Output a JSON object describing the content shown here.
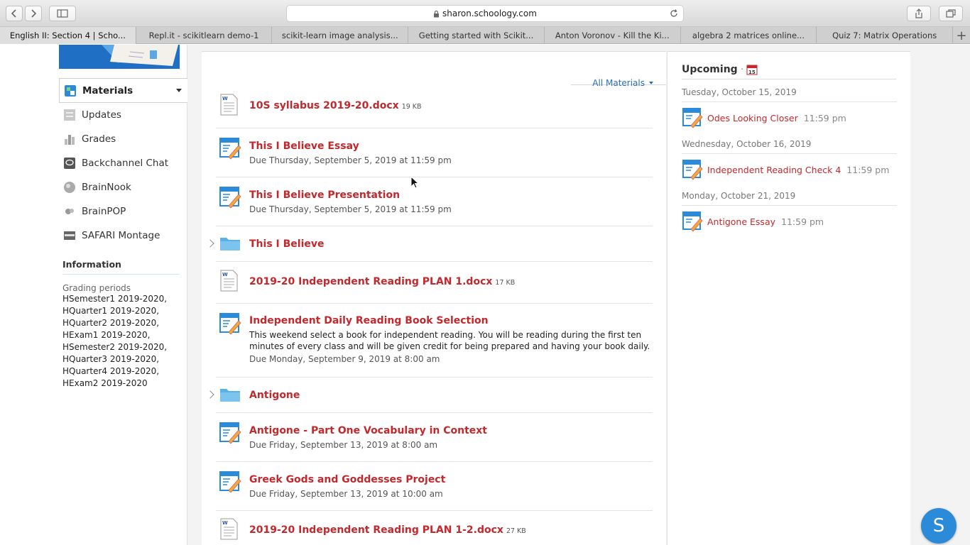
{
  "browser": {
    "url": "sharon.schoology.com",
    "tabs": [
      {
        "label": "English II: Section 4 | Scho..."
      },
      {
        "label": "Repl.it - scikitlearn demo-1"
      },
      {
        "label": "scikit-learn image analysis..."
      },
      {
        "label": "Getting started with Scikit..."
      },
      {
        "label": "Anton Voronov - Kill the Ki..."
      },
      {
        "label": "algebra 2 matrices online..."
      },
      {
        "label": "Quiz 7: Matrix Operations"
      }
    ],
    "new_tab": "+"
  },
  "sidebar": {
    "items": [
      {
        "label": "Materials"
      },
      {
        "label": "Updates"
      },
      {
        "label": "Grades"
      },
      {
        "label": "Backchannel Chat"
      },
      {
        "label": "BrainNook"
      },
      {
        "label": "BrainPOP"
      },
      {
        "label": "SAFARI Montage"
      }
    ],
    "info_title": "Information",
    "grading_label": "Grading periods",
    "grading_periods": [
      "HSemester1 2019-2020,",
      "HQuarter1 2019-2020,",
      "HQuarter2 2019-2020,",
      "HExam1 2019-2020,",
      "HSemester2 2019-2020,",
      "HQuarter3 2019-2020,",
      "HQuarter4 2019-2020,",
      "HExam2 2019-2020"
    ]
  },
  "materials": {
    "filter_label": "All Materials",
    "items": [
      {
        "type": "doc",
        "title": "10S syllabus 2019-20.docx",
        "size": "19 KB"
      },
      {
        "type": "assignment",
        "title": "This I Believe Essay",
        "due": "Due Thursday, September 5, 2019 at 11:59 pm"
      },
      {
        "type": "assignment",
        "title": "This I Believe Presentation",
        "due": "Due Thursday, September 5, 2019 at 11:59 pm"
      },
      {
        "type": "folder",
        "title": "This I Believe"
      },
      {
        "type": "doc",
        "title": "2019-20 Independent Reading PLAN 1.docx",
        "size": "17 KB"
      },
      {
        "type": "assignment",
        "title": "Independent Daily Reading Book Selection",
        "desc": "This weekend select a book for independent reading. You will be reading during the first ten minutes of every class and will be given credit for being prepared and having your book daily.",
        "due": "Due Monday, September 9, 2019 at 8:00 am"
      },
      {
        "type": "folder",
        "title": "Antigone"
      },
      {
        "type": "assignment",
        "title": "Antigone - Part One Vocabulary in Context",
        "due": "Due Friday, September 13, 2019 at 8:00 am"
      },
      {
        "type": "assignment",
        "title": "Greek Gods and Goddesses Project",
        "due": "Due Friday, September 13, 2019 at 10:00 am"
      },
      {
        "type": "doc",
        "title": "2019-20 Independent Reading PLAN 1-2.docx",
        "size": "27 KB"
      }
    ]
  },
  "upcoming": {
    "title": "Upcoming",
    "separator": "·",
    "calendar_day": "15",
    "groups": [
      {
        "date": "Tuesday, October 15, 2019",
        "item": "Odes Looking Closer",
        "time": "11:59 pm"
      },
      {
        "date": "Wednesday, October 16, 2019",
        "item": "Independent Reading Check 4",
        "time": "11:59 pm"
      },
      {
        "date": "Monday, October 21, 2019",
        "item": "Antigone Essay",
        "time": "11:59 pm"
      }
    ]
  },
  "fab_label": "S",
  "colors": {
    "link_red": "#c3282c",
    "accent_blue": "#2c8bd8",
    "filter_blue": "#2a6fb5"
  }
}
